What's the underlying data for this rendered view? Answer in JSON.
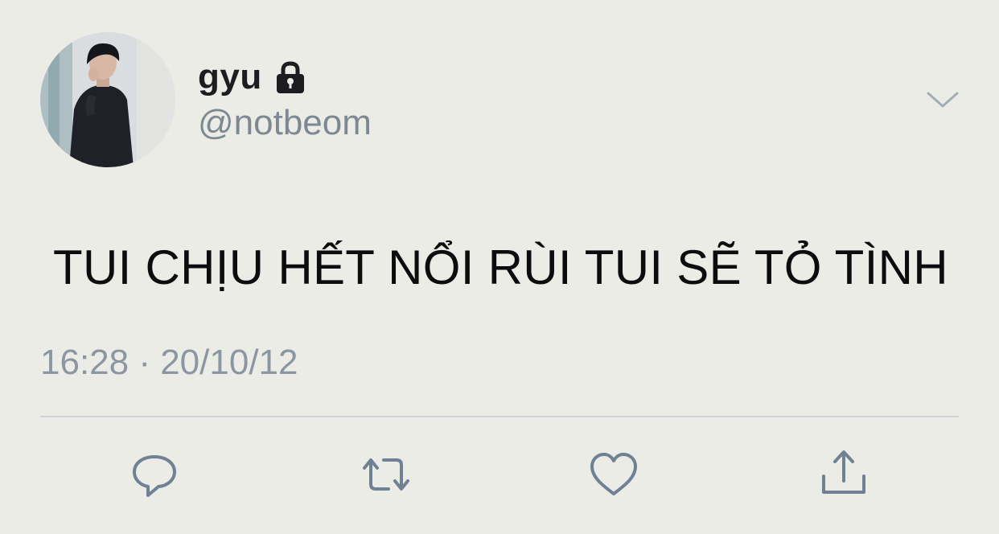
{
  "tweet": {
    "display_name": "gyu",
    "handle": "@notbeom",
    "text": "TUI CHỊU HẾT NỔI RÙI TUI SẼ TỎ TÌNH",
    "timestamp": "16:28 · 20/10/12",
    "protected": true
  },
  "icons": {
    "lock": "lock-icon",
    "menu": "chevron-down-icon",
    "reply": "reply-icon",
    "retweet": "retweet-icon",
    "like": "heart-icon",
    "share": "share-icon"
  },
  "colors": {
    "background": "#ecece6",
    "name": "#1c1d20",
    "secondary_text": "#7d8893",
    "icon": "#6f8193",
    "divider": "#cdd3d8"
  }
}
